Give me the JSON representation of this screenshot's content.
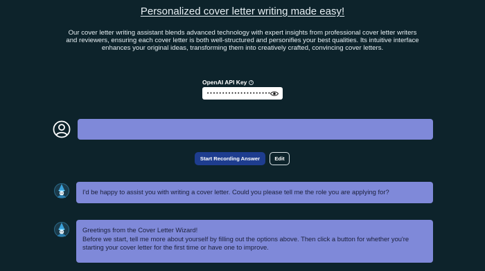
{
  "header": {
    "title": "Personalized cover letter writing made easy!",
    "description": "Our cover letter writing assistant blends advanced technology with expert insights from professional cover letter writers and reviewers, ensuring each cover letter is both well-structured and personifies your best qualities. Its intuitive interface enhances your original ideas, transforming them into creatively crafted, convincing cover letters."
  },
  "api_key": {
    "label": "OpenAI API Key",
    "value": "••••••••••••••••••••••••••••••",
    "info_icon": "info-icon",
    "visibility_icon": "eye-icon"
  },
  "user_input": {
    "avatar_icon": "user-circle-icon",
    "value": ""
  },
  "actions": {
    "record_label": "Start Recording Answer",
    "edit_label": "Edit"
  },
  "messages": [
    {
      "avatar_icon": "wizard-bot-icon",
      "lines": [
        "I'd be happy to assist you with writing a cover letter. Could you please tell me the role you are applying for?"
      ]
    },
    {
      "avatar_icon": "wizard-bot-icon",
      "lines": [
        "Greetings from the Cover Letter Wizard!",
        "Before we start, tell me more about yourself by filling out the options above. Then click a button for whether you're starting your cover letter for the first time or have one to improve."
      ]
    }
  ],
  "colors": {
    "background": "#0d232b",
    "message_bubble": "#7f89d9",
    "primary_button": "#1e3d8f"
  }
}
